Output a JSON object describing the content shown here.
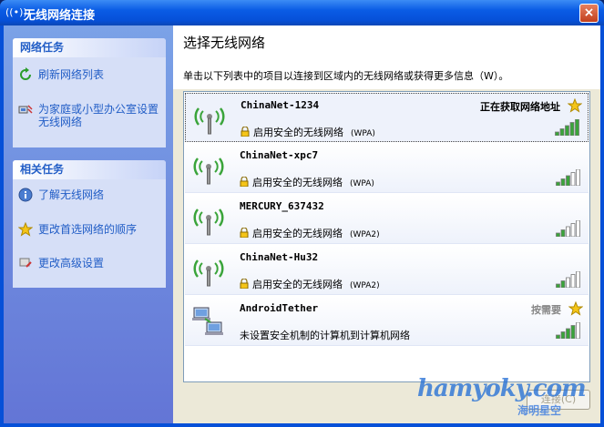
{
  "window": {
    "title": "无线网络连接",
    "close_label": "×",
    "title_icon": "((•))"
  },
  "sidebar": {
    "network_tasks": {
      "header": "网络任务",
      "items": [
        {
          "label": "刷新网络列表",
          "icon": "refresh-icon"
        },
        {
          "label": "为家庭或小型办公室设置无线网络",
          "icon": "home-network-icon"
        }
      ]
    },
    "related_tasks": {
      "header": "相关任务",
      "items": [
        {
          "label": "了解无线网络",
          "icon": "info-icon"
        },
        {
          "label": "更改首选网络的顺序",
          "icon": "star-icon"
        },
        {
          "label": "更改高级设置",
          "icon": "settings-icon"
        }
      ]
    }
  },
  "main": {
    "heading": "选择无线网络",
    "description": "单击以下列表中的项目以连接到区域内的无线网络或获得更多信息（W）。",
    "networks": [
      {
        "name": "ChinaNet-1234",
        "security": "启用安全的无线网络",
        "security_type": "(WPA)",
        "status": "正在获取网络地址",
        "preferred": true,
        "signal": 5,
        "type": "infrastructure"
      },
      {
        "name": "ChinaNet-xpc7",
        "security": "启用安全的无线网络",
        "security_type": "(WPA)",
        "status": "",
        "preferred": false,
        "signal": 3,
        "type": "infrastructure"
      },
      {
        "name": "MERCURY_637432",
        "security": "启用安全的无线网络",
        "security_type": "(WPA2)",
        "status": "",
        "preferred": false,
        "signal": 2,
        "type": "infrastructure"
      },
      {
        "name": "ChinaNet-Hu32",
        "security": "启用安全的无线网络",
        "security_type": "(WPA2)",
        "status": "",
        "preferred": false,
        "signal": 2,
        "type": "infrastructure"
      },
      {
        "name": "AndroidTether",
        "security": "未设置安全机制的计算机到计算机网络",
        "security_type": "",
        "status": "按需要",
        "preferred": true,
        "signal": 4,
        "type": "adhoc"
      }
    ],
    "connect_label": "连接(C)"
  },
  "watermark": {
    "text": "hamyoky.com",
    "subtext": "海明星空"
  },
  "colors": {
    "title_blue": "#0650d8",
    "link_blue": "#215dc6",
    "signal_green": "#3aa43a",
    "star_gold": "#f5c518"
  }
}
